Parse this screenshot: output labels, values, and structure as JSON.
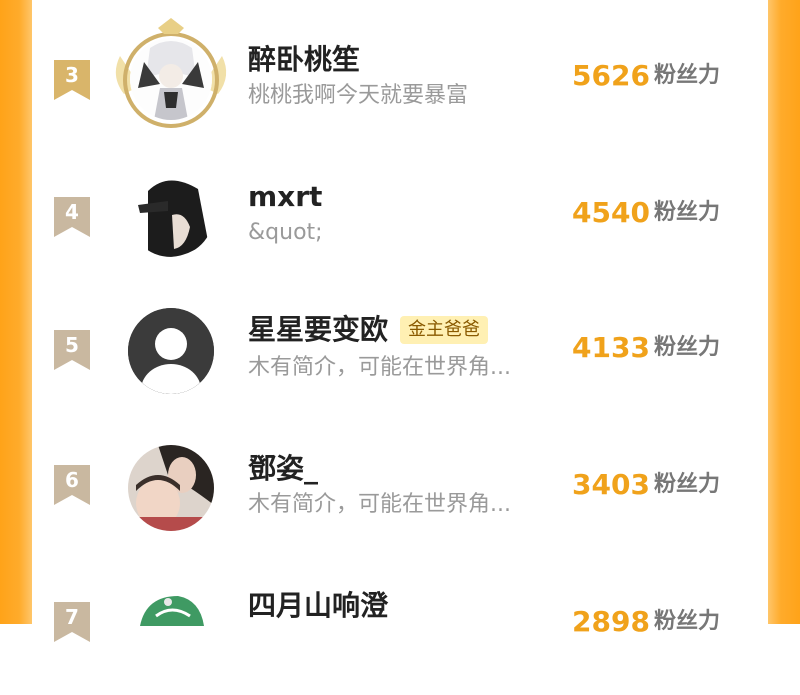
{
  "rows": [
    {
      "rank": "3",
      "name": "醉卧桃笙",
      "bio": "桃桃我啊今天就要暴富",
      "count": "5626",
      "unit": "粉丝力",
      "badge": ""
    },
    {
      "rank": "4",
      "name": "mxrt",
      "bio": "&quot;",
      "count": "4540",
      "unit": "粉丝力",
      "badge": ""
    },
    {
      "rank": "5",
      "name": "星星要变欧",
      "bio": "木有简介，可能在世界角...",
      "count": "4133",
      "unit": "粉丝力",
      "badge": "金主爸爸"
    },
    {
      "rank": "6",
      "name": "鄧姿_",
      "bio": "木有简介，可能在世界角...",
      "count": "3403",
      "unit": "粉丝力",
      "badge": ""
    },
    {
      "rank": "7",
      "name": "四月山响澄",
      "bio": "",
      "count": "2898",
      "unit": "粉丝力",
      "badge": ""
    }
  ],
  "colors": {
    "accent": "#f0a21b",
    "rank3": "#d9b56a",
    "rank_other": "#c9b8a0",
    "side": "#ffa319"
  }
}
